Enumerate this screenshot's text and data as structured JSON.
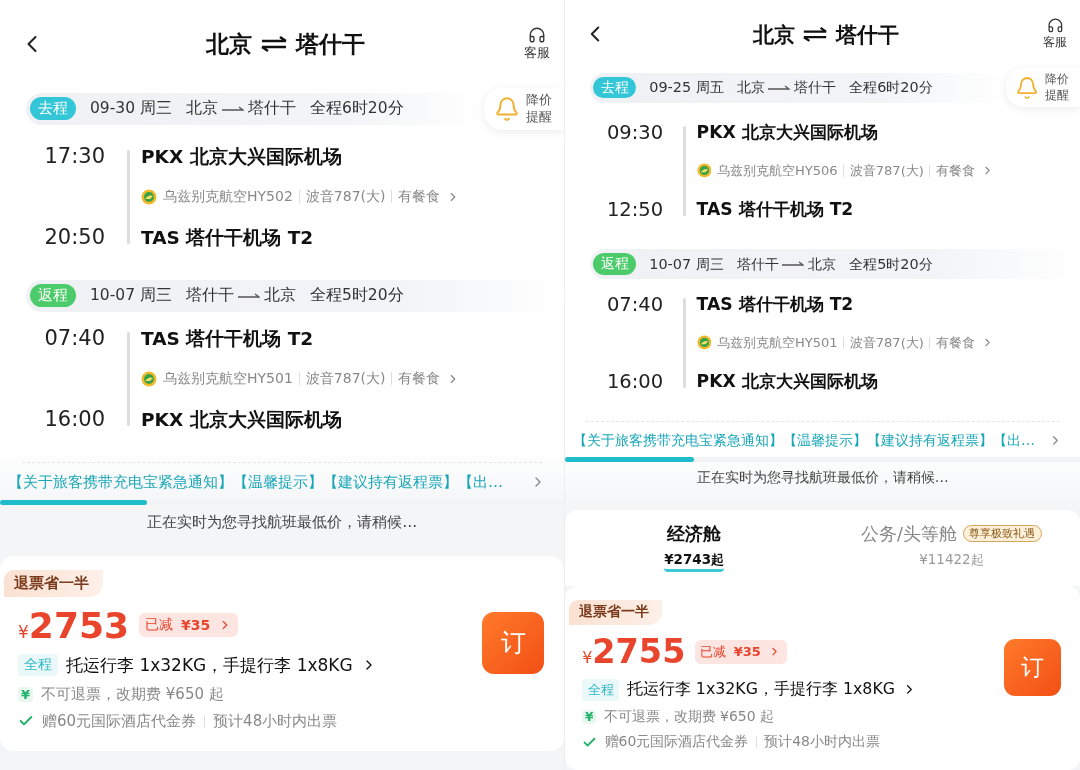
{
  "screens": [
    {
      "title_from": "北京",
      "title_to": "塔什干",
      "service_label": "客服",
      "price_alert": "降价提醒",
      "segments": [
        {
          "tag": "去程",
          "color": "#33c6d6",
          "date": "09-30 周三",
          "from": "北京",
          "to": "塔什干",
          "duration": "全程6时20分",
          "depart_time": "17:30",
          "depart_airport": "PKX 北京大兴国际机场",
          "airline": "乌兹别克航空HY502",
          "aircraft": "波音787(大)",
          "meal": "有餐食",
          "arrive_time": "20:50",
          "arrive_airport": "TAS 塔什干机场 T2"
        },
        {
          "tag": "返程",
          "color": "#4ccb6a",
          "date": "10-07 周三",
          "from": "塔什干",
          "to": "北京",
          "duration": "全程5时20分",
          "depart_time": "07:40",
          "depart_airport": "TAS 塔什干机场 T2",
          "airline": "乌兹别克航空HY501",
          "aircraft": "波音787(大)",
          "meal": "有餐食",
          "arrive_time": "16:00",
          "arrive_airport": "PKX 北京大兴国际机场"
        }
      ],
      "notice": "【关于旅客携带充电宝紧急通知】【温馨提示】【建议持有返程票】【出…",
      "progress": {
        "level": 0.26
      },
      "loading_text": "正在实时为您寻找航班最低价，请稍候…",
      "fare": {
        "tag": "退票省一半",
        "currency": "¥",
        "price": "2753",
        "discount_label": "已减",
        "discount_amount": "¥35",
        "baggage_tag": "全程",
        "baggage": "托运行李 1x32KG，手提行李 1x8KG",
        "rule_icon": "¥",
        "rule": "不可退票，改期费 ¥650 起",
        "gift": "赠60元国际酒店代金券",
        "ticketing": "预计48小时内出票",
        "book_label": "订"
      }
    },
    {
      "title_from": "北京",
      "title_to": "塔什干",
      "service_label": "客服",
      "price_alert": "降价提醒",
      "segments": [
        {
          "tag": "去程",
          "color": "#33c6d6",
          "date": "09-25 周五",
          "from": "北京",
          "to": "塔什干",
          "duration": "全程6时20分",
          "depart_time": "09:30",
          "depart_airport": "PKX 北京大兴国际机场",
          "airline": "乌兹别克航空HY506",
          "aircraft": "波音787(大)",
          "meal": "有餐食",
          "arrive_time": "12:50",
          "arrive_airport": "TAS 塔什干机场 T2"
        },
        {
          "tag": "返程",
          "color": "#4ccb6a",
          "date": "10-07 周三",
          "from": "塔什干",
          "to": "北京",
          "duration": "全程5时20分",
          "depart_time": "07:40",
          "depart_airport": "TAS 塔什干机场 T2",
          "airline": "乌兹别克航空HY501",
          "aircraft": "波音787(大)",
          "meal": "有餐食",
          "arrive_time": "16:00",
          "arrive_airport": "PKX 北京大兴国际机场"
        }
      ],
      "notice": "【关于旅客携带充电宝紧急通知】【温馨提示】【建议持有返程票】【出…",
      "progress": {
        "level": 0.25
      },
      "loading_text": "正在实时为您寻找航班最低价，请稍候…",
      "cabin_tabs": [
        {
          "label": "经济舱",
          "price": "¥2743起",
          "selected": true
        },
        {
          "label": "公务/头等舱",
          "price": "¥11422起",
          "selected": false,
          "badge": "尊享极致礼遇"
        }
      ],
      "fare": {
        "tag": "退票省一半",
        "currency": "¥",
        "price": "2755",
        "discount_label": "已减",
        "discount_amount": "¥35",
        "baggage_tag": "全程",
        "baggage": "托运行李 1x32KG，手提行李 1x8KG",
        "rule_icon": "¥",
        "rule": "不可退票，改期费 ¥650 起",
        "gift": "赠60元国际酒店代金券",
        "ticketing": "预计48小时内出票",
        "book_label": "订"
      }
    }
  ]
}
